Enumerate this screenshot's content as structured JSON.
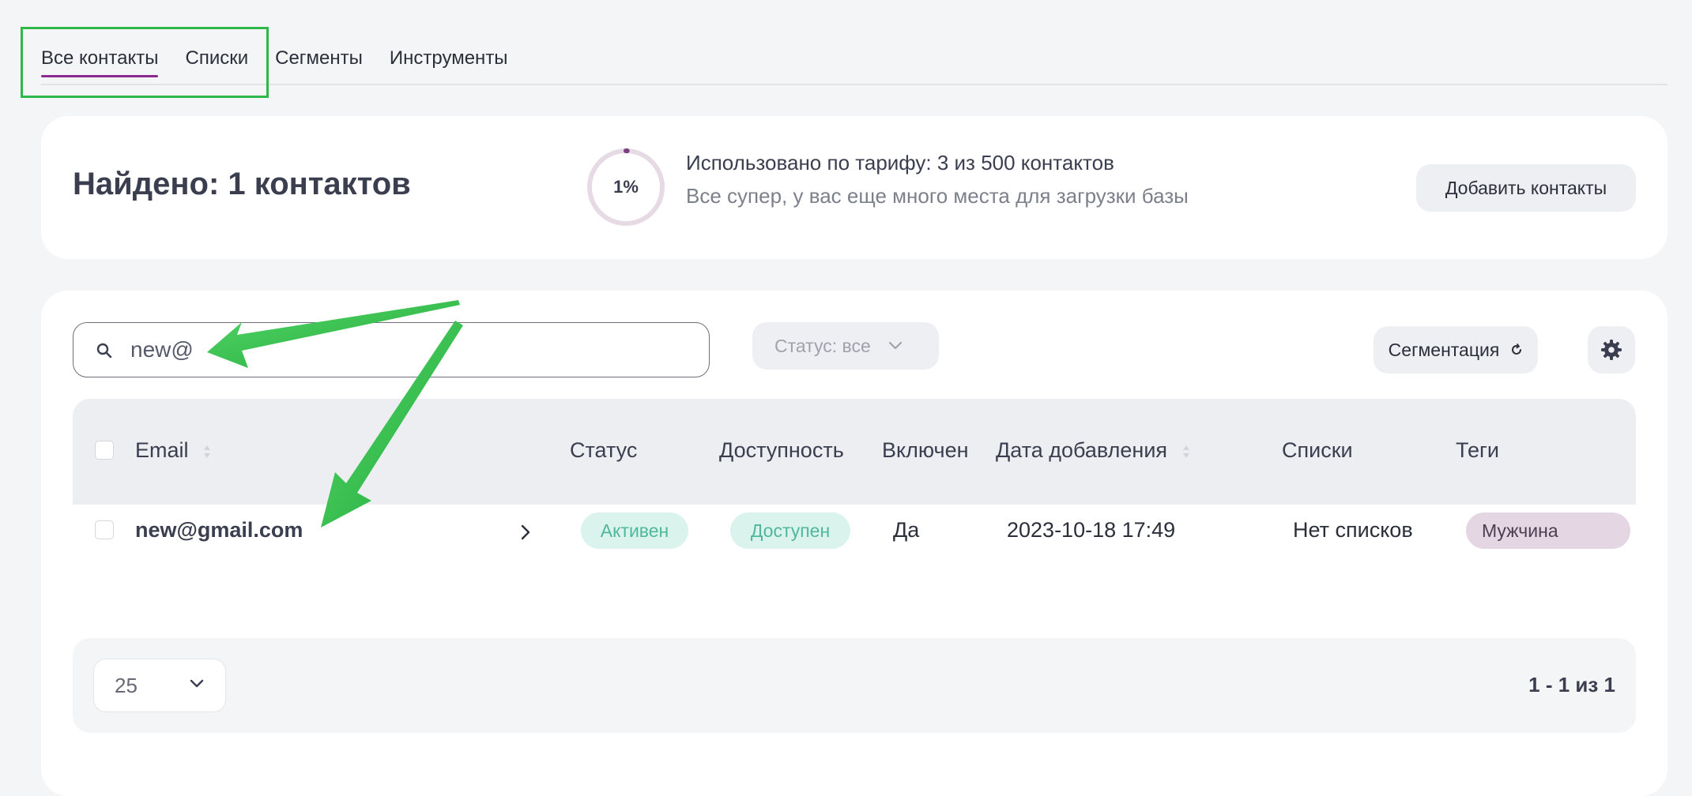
{
  "tabs": [
    {
      "label": "Все контакты",
      "active": true
    },
    {
      "label": "Списки",
      "active": false
    },
    {
      "label": "Сегменты",
      "active": false
    },
    {
      "label": "Инструменты",
      "active": false
    }
  ],
  "summary": {
    "found": "Найдено: 1 контактов",
    "usage_percent_label": "1%",
    "usage_fraction": 0.006,
    "usage_title": "Использовано по тарифу: 3 из 500 контактов",
    "usage_subtitle": "Все супер, у вас еще много места для загрузки базы",
    "add_button": "Добавить контакты"
  },
  "toolbar": {
    "search_value": "new@",
    "search_icon": "search-icon",
    "status_filter": "Статус: все",
    "segmentation_button": "Сегментация",
    "settings_icon": "gear-icon"
  },
  "table": {
    "columns": [
      "Email",
      "Статус",
      "Доступность",
      "Включен",
      "Дата добавления",
      "Списки",
      "Теги"
    ],
    "rows": [
      {
        "email": "new@gmail.com",
        "status": "Активен",
        "availability": "Доступен",
        "included": "Да",
        "date_added": "2023-10-18 17:49",
        "lists": "Нет списков",
        "tags": "Мужчина"
      }
    ]
  },
  "footer": {
    "page_size": "25",
    "pagination": "1 - 1 из 1"
  },
  "colors": {
    "accent": "#8a2a8f",
    "annotation_green": "#2eb84a",
    "badge_green_bg": "#daf3ec",
    "badge_green_text": "#4fb89a",
    "tag_bg": "#e5d6e3"
  }
}
